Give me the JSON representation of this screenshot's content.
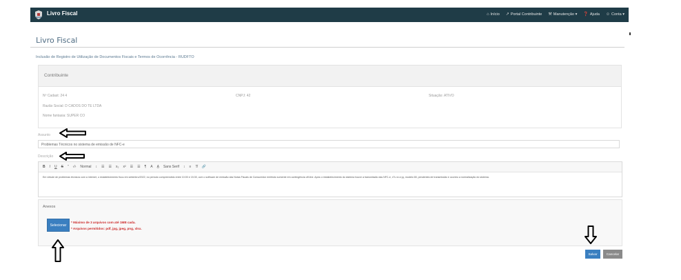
{
  "navbar": {
    "brand_title": "Livro Fiscal",
    "menu": [
      {
        "icon": "home-icon",
        "glyph": "⌂",
        "label": "Início"
      },
      {
        "icon": "external-link-icon",
        "glyph": "↗",
        "label": "Portal Contribuinte"
      },
      {
        "icon": "wrench-icon",
        "glyph": "⚒",
        "label": "Manutenção ▾"
      },
      {
        "icon": "help-icon",
        "glyph": "❓",
        "label": "Ajuda"
      },
      {
        "icon": "user-icon",
        "glyph": "☺",
        "label": "Conta ▾"
      }
    ]
  },
  "page": {
    "title": "Livro Fiscal",
    "subtitle": "Inclusão de Registro de Utilização de Documentos Fiscais e Termos de Ocorrência - RUDFTO"
  },
  "contribuinte": {
    "title": "Contribuinte",
    "cadastro": "Nº Cadast: 24 4",
    "cnpj": "CNPJ: 42",
    "situacao": "Situação: ATIVO",
    "razao_social": "Razão Social: D CADOS DO TE LTDA",
    "nome_fantasia": "Nome fantasia: SUPER CO"
  },
  "assunto": {
    "label": "Assunto",
    "value": "Problemas Técnicos no sistema de emissão de NFC-e"
  },
  "descricao": {
    "label": "Descrição",
    "toolbar": [
      "B",
      "I",
      "U",
      "S",
      "”",
      "‹/›",
      "Normal",
      "↕",
      "☰",
      "☰",
      "x₂",
      "x²",
      "☰",
      "☰",
      "¶",
      "A",
      "A̲",
      "Sans Serif",
      "↕",
      "≡",
      "T̸",
      "🔗"
    ],
    "content": "Em virtude de problemas técnicos com a internet, o estabelecimento ficou em setembro/2022, no período compreendido entre 10:00 e 15:30, com o software de emissão das Notas Fiscais de Consumidor emitindo somente em contingência off-line. Após o restabelecimento do sistema houve a transmissão das NFC-e, n°s xx a yy, modelo 65, pendentes de transmissão e ocorreu a normalização do sistema."
  },
  "anexos": {
    "title": "Anexos",
    "button_label": "Selecionar",
    "hint_max": "* Máximo de 3 arquivos com até 1MB cada.",
    "hint_types": "* Arquivos permitidos: pdf, jpg, jpeg, png, xlsx."
  },
  "footer": {
    "save_label": "Salvar",
    "cancel_label": "Cancelar"
  }
}
